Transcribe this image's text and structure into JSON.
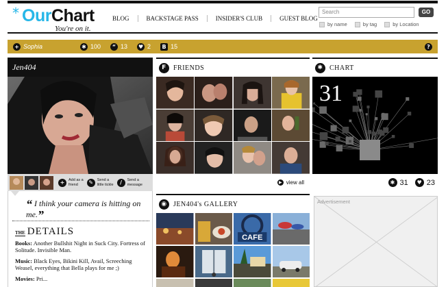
{
  "logo": {
    "mark": "*",
    "our": "Our",
    "chart": "Chart",
    "tagline": "You're on it."
  },
  "nav": [
    "BLOG",
    "BACKSTAGE PASS",
    "INSIDER'S CLUB",
    "GUEST BLOG"
  ],
  "search": {
    "placeholder": "Search",
    "go": "GO",
    "filters": [
      "by name",
      "by tag",
      "by Location"
    ]
  },
  "status": {
    "user": "Sophia",
    "stars": "100",
    "quotes": "13",
    "hearts": "2",
    "boards": "15",
    "help": "?"
  },
  "profile": {
    "name": "Jen404",
    "actions": [
      {
        "label1": "Add as a",
        "label2": "friend"
      },
      {
        "label1": "Send a",
        "label2": "little tickle"
      },
      {
        "label1": "Send a",
        "label2": "message"
      }
    ],
    "quote": "I think your camera is hitting on me.",
    "details_the": "THE",
    "details_title": "DETAILS",
    "details": [
      {
        "label": "Books:",
        "text": "Another Bullshit Night in Suck City. Fortress of Solitude. Invisible Man."
      },
      {
        "label": "Music:",
        "text": "Black Eyes, Bikini Kill, Avail, Screeching Weasel, everything that Bella plays for me ;)"
      },
      {
        "label": "Movies:",
        "text": "Pri..."
      }
    ]
  },
  "friends": {
    "title": "FRIENDS",
    "view_all": "view all"
  },
  "chart": {
    "title": "CHART",
    "number": "31",
    "count_stars": "31",
    "count_hearts": "23"
  },
  "gallery": {
    "title": "JEN404's GALLERY",
    "cafe_sign": "CAFE"
  },
  "ad": {
    "label": "Advertisement"
  },
  "colors": {
    "accent": "#27b7e8",
    "statusbar": "#c8a22f",
    "dark": "#111111"
  },
  "icons": {
    "status_user": "plus-icon",
    "status_stars": "star-icon",
    "status_quotes": "quote-icon",
    "status_hearts": "heart-icon",
    "status_boards": "board-icon",
    "help": "help-icon",
    "friends": "facebook-f-icon",
    "chart": "asterisk-icon",
    "gallery": "camera-icon"
  }
}
